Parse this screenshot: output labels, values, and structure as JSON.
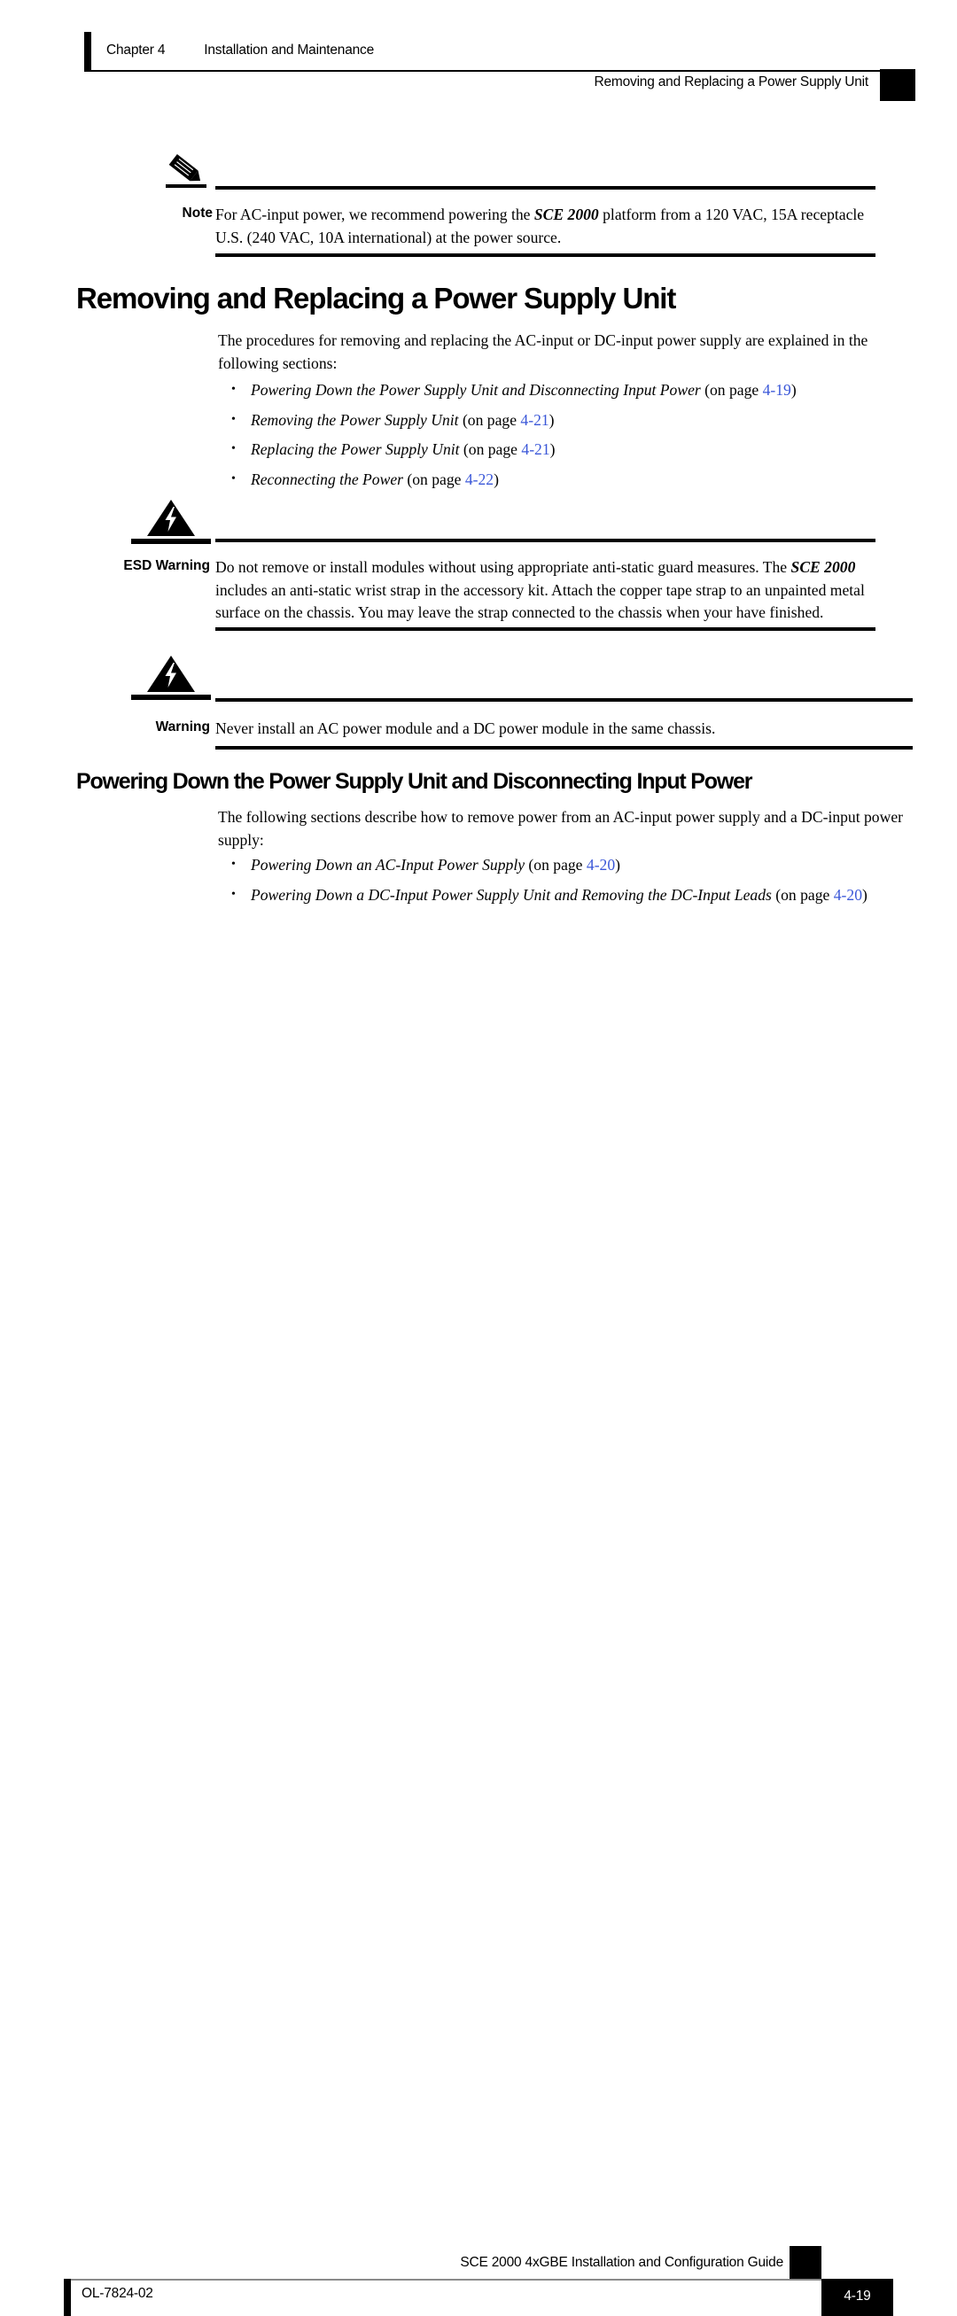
{
  "header": {
    "chapter_label": "Chapter 4",
    "chapter_title": "Installation and Maintenance",
    "running_title": "Removing and Replacing a Power Supply Unit"
  },
  "note": {
    "label": "Note",
    "icon": "pencil-note-icon",
    "text_before": "For AC-input power, we recommend powering the ",
    "emphasis": "SCE 2000",
    "text_after": " platform from a 120 VAC, 15A receptacle U.S. (240 VAC, 10A international) at the power source."
  },
  "section1": {
    "heading": "Removing and Replacing a Power Supply Unit",
    "intro": "The procedures for removing and replacing the AC-input or DC-input power supply are explained in the following sections:",
    "links": [
      {
        "title": "Powering Down the Power Supply Unit and Disconnecting Input Power",
        "on_page": " (on page ",
        "page": "4-19",
        "close": ")"
      },
      {
        "title": "Removing the Power Supply Unit",
        "on_page": " (on page ",
        "page": "4-21",
        "close": ")"
      },
      {
        "title": "Replacing the Power Supply Unit",
        "on_page": " (on page ",
        "page": "4-21",
        "close": ")"
      },
      {
        "title": "Reconnecting the Power",
        "on_page": " (on page ",
        "page": "4-22",
        "close": ")"
      }
    ]
  },
  "esd_warning": {
    "label": "ESD Warning",
    "icon": "warning-triangle-icon",
    "text_before": "Do not remove or install modules without using appropriate anti-static guard measures. The ",
    "emphasis": "SCE 2000",
    "text_after": " includes an anti-static wrist strap in the accessory kit. Attach the copper tape strap to an unpainted metal surface on the chassis. You may leave the strap connected to the chassis when your have finished."
  },
  "warning": {
    "label": "Warning",
    "icon": "warning-triangle-icon",
    "text": "Never install an AC power module and a DC power module in the same chassis."
  },
  "section2": {
    "heading": "Powering Down the Power Supply Unit and Disconnecting Input Power",
    "intro": "The following sections describe how to remove power from an AC-input power supply and a DC-input power supply:",
    "links": [
      {
        "title": "Powering Down an AC-Input Power Supply",
        "on_page": " (on page ",
        "page": "4-20",
        "close": ")"
      },
      {
        "title": "Powering Down a DC-Input Power Supply Unit and Removing the DC-Input Leads",
        "on_page": " (on page ",
        "page": "4-20",
        "close": ")"
      }
    ]
  },
  "footer": {
    "guide_title": "SCE 2000 4xGBE Installation and Configuration Guide",
    "doc_id": "OL-7824-02",
    "page_number": "4-19"
  },
  "colors": {
    "link_blue": "#3a57d8",
    "rule_black": "#000000",
    "footer_rule_gray": "#8a8a8a"
  }
}
